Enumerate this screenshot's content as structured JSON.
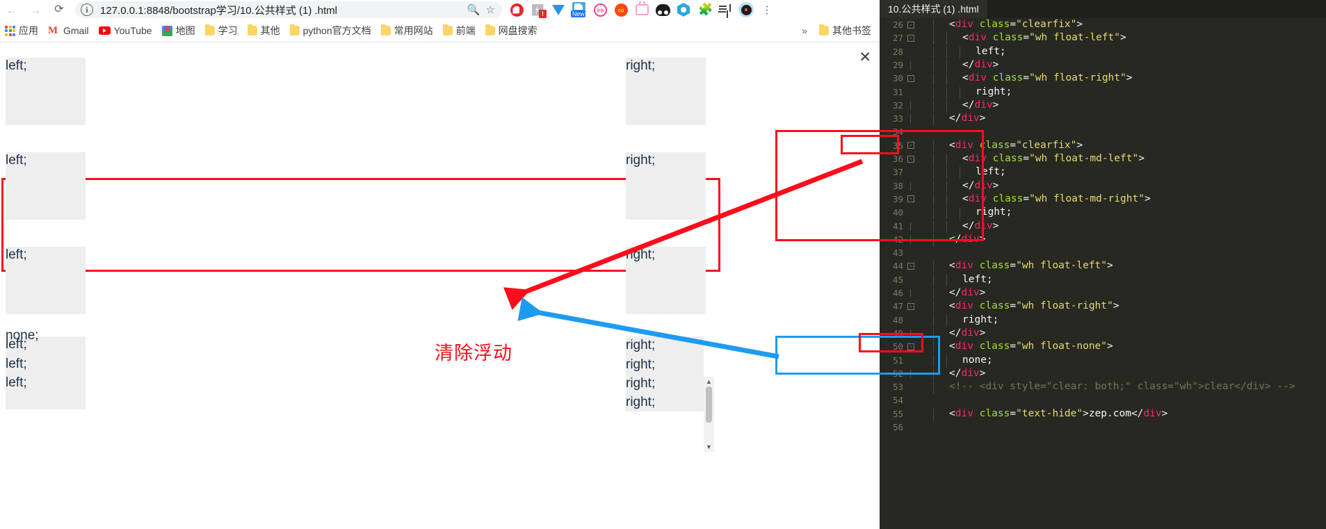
{
  "browser": {
    "nav": {
      "back_icon": "arrow-left-icon",
      "forward_icon": "arrow-right-icon",
      "reload_icon": "reload-icon"
    },
    "omnibox": {
      "info_icon": "site-info-icon",
      "url": "127.0.0.1:8848/bootstrap学习/10.公共样式 (1) .html",
      "zoom_icon": "zoom-icon",
      "star_icon": "bookmark-star-icon"
    },
    "extensions": [
      {
        "name": "adblock-extension-icon"
      },
      {
        "name": "tampermonkey-extension-icon",
        "badge": "!"
      },
      {
        "name": "diamond-extension-icon"
      },
      {
        "name": "new-tab-extension-icon",
        "badge": "New"
      },
      {
        "name": "fast-forward-extension-icon"
      },
      {
        "name": "infinity-extension-icon"
      },
      {
        "name": "tv-extension-icon"
      },
      {
        "name": "panda-extension-icon"
      },
      {
        "name": "hexagon-extension-icon"
      },
      {
        "name": "puzzle-extensions-icon"
      },
      {
        "name": "notes-music-extension-icon"
      },
      {
        "name": "profile-avatar-icon"
      },
      {
        "name": "kebab-menu-icon"
      }
    ],
    "bookmarks": [
      {
        "label": "应用",
        "icon": "apps-grid-icon"
      },
      {
        "label": "Gmail",
        "icon": "gmail-icon"
      },
      {
        "label": "YouTube",
        "icon": "youtube-icon"
      },
      {
        "label": "地图",
        "icon": "google-maps-icon"
      },
      {
        "label": "学习",
        "icon": "folder-icon"
      },
      {
        "label": "其他",
        "icon": "folder-icon"
      },
      {
        "label": "python官方文档",
        "icon": "folder-icon"
      },
      {
        "label": "常用网站",
        "icon": "folder-icon"
      },
      {
        "label": "前端",
        "icon": "folder-icon"
      },
      {
        "label": "网盘搜索",
        "icon": "folder-icon"
      }
    ],
    "bookmark_overflow_label": "»",
    "other_bookmarks": {
      "label": "其他书签",
      "icon": "folder-icon"
    }
  },
  "page": {
    "close_label": "✕",
    "boxes": {
      "left": "left;",
      "right": "right;",
      "none": "none;"
    },
    "rows": [
      {
        "left": "left;",
        "right": "right;",
        "highlighted": false
      },
      {
        "left": "left;",
        "right": "right;",
        "highlighted": true
      },
      {
        "left": "left;",
        "right": "right;",
        "highlighted": false
      }
    ],
    "bottom_stack": {
      "none": "none;",
      "lefts": [
        "left;",
        "left;",
        "left;"
      ],
      "rights": [
        "right;",
        "right;",
        "right;",
        "right;"
      ]
    },
    "scrollbar": {
      "up_arrow": "▲",
      "down_arrow": "▼"
    }
  },
  "annotation": {
    "text": "清除浮动",
    "red_color": "#fc0d1b",
    "blue_color": "#1e9bf0"
  },
  "editor": {
    "tab_title": "10.公共样式 (1) .html",
    "lines": [
      {
        "no": "26",
        "fold": "minus",
        "indent": 2,
        "tokens": [
          {
            "t": "<",
            "c": "pun"
          },
          {
            "t": "div",
            "c": "tag"
          },
          {
            "t": " ",
            "c": "txt"
          },
          {
            "t": "class",
            "c": "attr"
          },
          {
            "t": "=",
            "c": "pun"
          },
          {
            "t": "\"clearfix\"",
            "c": "str"
          },
          {
            "t": ">",
            "c": "pun"
          }
        ]
      },
      {
        "no": "27",
        "fold": "minus",
        "indent": 3,
        "tokens": [
          {
            "t": "<",
            "c": "pun"
          },
          {
            "t": "div",
            "c": "tag"
          },
          {
            "t": " ",
            "c": "txt"
          },
          {
            "t": "class",
            "c": "attr"
          },
          {
            "t": "=",
            "c": "pun"
          },
          {
            "t": "\"wh float-left\"",
            "c": "str"
          },
          {
            "t": ">",
            "c": "pun"
          }
        ]
      },
      {
        "no": "28",
        "fold": "",
        "indent": 4,
        "tokens": [
          {
            "t": "left;",
            "c": "txt"
          }
        ]
      },
      {
        "no": "29",
        "fold": "line",
        "indent": 3,
        "tokens": [
          {
            "t": "</",
            "c": "pun"
          },
          {
            "t": "div",
            "c": "tag"
          },
          {
            "t": ">",
            "c": "pun"
          }
        ]
      },
      {
        "no": "30",
        "fold": "minus",
        "indent": 3,
        "tokens": [
          {
            "t": "<",
            "c": "pun"
          },
          {
            "t": "div",
            "c": "tag"
          },
          {
            "t": " ",
            "c": "txt"
          },
          {
            "t": "class",
            "c": "attr"
          },
          {
            "t": "=",
            "c": "pun"
          },
          {
            "t": "\"wh float-right\"",
            "c": "str"
          },
          {
            "t": ">",
            "c": "pun"
          }
        ]
      },
      {
        "no": "31",
        "fold": "",
        "indent": 4,
        "tokens": [
          {
            "t": "right;",
            "c": "txt"
          }
        ]
      },
      {
        "no": "32",
        "fold": "line",
        "indent": 3,
        "tokens": [
          {
            "t": "</",
            "c": "pun"
          },
          {
            "t": "div",
            "c": "tag"
          },
          {
            "t": ">",
            "c": "pun"
          }
        ]
      },
      {
        "no": "33",
        "fold": "line",
        "indent": 2,
        "tokens": [
          {
            "t": "</",
            "c": "pun"
          },
          {
            "t": "div",
            "c": "tag"
          },
          {
            "t": ">",
            "c": "pun"
          }
        ]
      },
      {
        "no": "34",
        "fold": "",
        "indent": 0,
        "tokens": []
      },
      {
        "no": "35",
        "fold": "minus",
        "indent": 2,
        "tokens": [
          {
            "t": "<",
            "c": "pun"
          },
          {
            "t": "div",
            "c": "tag"
          },
          {
            "t": " ",
            "c": "txt"
          },
          {
            "t": "class",
            "c": "attr"
          },
          {
            "t": "=",
            "c": "pun"
          },
          {
            "t": "\"clearfix\"",
            "c": "str"
          },
          {
            "t": ">",
            "c": "pun"
          }
        ]
      },
      {
        "no": "36",
        "fold": "minus",
        "indent": 3,
        "tokens": [
          {
            "t": "<",
            "c": "pun"
          },
          {
            "t": "div",
            "c": "tag"
          },
          {
            "t": " ",
            "c": "txt"
          },
          {
            "t": "class",
            "c": "attr"
          },
          {
            "t": "=",
            "c": "pun"
          },
          {
            "t": "\"wh float-md-left\"",
            "c": "str"
          },
          {
            "t": ">",
            "c": "pun"
          }
        ]
      },
      {
        "no": "37",
        "fold": "",
        "indent": 4,
        "tokens": [
          {
            "t": "left;",
            "c": "txt"
          }
        ]
      },
      {
        "no": "38",
        "fold": "line",
        "indent": 3,
        "tokens": [
          {
            "t": "</",
            "c": "pun"
          },
          {
            "t": "div",
            "c": "tag"
          },
          {
            "t": ">",
            "c": "pun"
          }
        ]
      },
      {
        "no": "39",
        "fold": "minus",
        "indent": 3,
        "tokens": [
          {
            "t": "<",
            "c": "pun"
          },
          {
            "t": "div",
            "c": "tag"
          },
          {
            "t": " ",
            "c": "txt"
          },
          {
            "t": "class",
            "c": "attr"
          },
          {
            "t": "=",
            "c": "pun"
          },
          {
            "t": "\"wh float-md-right\"",
            "c": "str"
          },
          {
            "t": ">",
            "c": "pun"
          }
        ]
      },
      {
        "no": "40",
        "fold": "",
        "indent": 4,
        "tokens": [
          {
            "t": "right;",
            "c": "txt"
          }
        ]
      },
      {
        "no": "41",
        "fold": "line",
        "indent": 3,
        "tokens": [
          {
            "t": "</",
            "c": "pun"
          },
          {
            "t": "div",
            "c": "tag"
          },
          {
            "t": ">",
            "c": "pun"
          }
        ]
      },
      {
        "no": "42",
        "fold": "line",
        "indent": 2,
        "tokens": [
          {
            "t": "</",
            "c": "pun"
          },
          {
            "t": "div",
            "c": "tag"
          },
          {
            "t": ">",
            "c": "pun"
          }
        ]
      },
      {
        "no": "43",
        "fold": "",
        "indent": 0,
        "tokens": []
      },
      {
        "no": "44",
        "fold": "minus",
        "indent": 2,
        "tokens": [
          {
            "t": "<",
            "c": "pun"
          },
          {
            "t": "div",
            "c": "tag"
          },
          {
            "t": " ",
            "c": "txt"
          },
          {
            "t": "class",
            "c": "attr"
          },
          {
            "t": "=",
            "c": "pun"
          },
          {
            "t": "\"wh float-left\"",
            "c": "str"
          },
          {
            "t": ">",
            "c": "pun"
          }
        ]
      },
      {
        "no": "45",
        "fold": "",
        "indent": 3,
        "tokens": [
          {
            "t": "left;",
            "c": "txt"
          }
        ]
      },
      {
        "no": "46",
        "fold": "line",
        "indent": 2,
        "tokens": [
          {
            "t": "</",
            "c": "pun"
          },
          {
            "t": "div",
            "c": "tag"
          },
          {
            "t": ">",
            "c": "pun"
          }
        ]
      },
      {
        "no": "47",
        "fold": "minus",
        "indent": 2,
        "tokens": [
          {
            "t": "<",
            "c": "pun"
          },
          {
            "t": "div",
            "c": "tag"
          },
          {
            "t": " ",
            "c": "txt"
          },
          {
            "t": "class",
            "c": "attr"
          },
          {
            "t": "=",
            "c": "pun"
          },
          {
            "t": "\"wh float-right\"",
            "c": "str"
          },
          {
            "t": ">",
            "c": "pun"
          }
        ]
      },
      {
        "no": "48",
        "fold": "",
        "indent": 3,
        "tokens": [
          {
            "t": "right;",
            "c": "txt"
          }
        ]
      },
      {
        "no": "49",
        "fold": "line",
        "indent": 2,
        "tokens": [
          {
            "t": "</",
            "c": "pun"
          },
          {
            "t": "div",
            "c": "tag"
          },
          {
            "t": ">",
            "c": "pun"
          }
        ]
      },
      {
        "no": "50",
        "fold": "minus",
        "indent": 2,
        "tokens": [
          {
            "t": "<",
            "c": "pun"
          },
          {
            "t": "div",
            "c": "tag"
          },
          {
            "t": " ",
            "c": "txt"
          },
          {
            "t": "class",
            "c": "attr"
          },
          {
            "t": "=",
            "c": "pun"
          },
          {
            "t": "\"wh float-none\"",
            "c": "str"
          },
          {
            "t": ">",
            "c": "pun"
          }
        ]
      },
      {
        "no": "51",
        "fold": "",
        "indent": 3,
        "tokens": [
          {
            "t": "none;",
            "c": "txt"
          }
        ]
      },
      {
        "no": "52",
        "fold": "line",
        "indent": 2,
        "tokens": [
          {
            "t": "</",
            "c": "pun"
          },
          {
            "t": "div",
            "c": "tag"
          },
          {
            "t": ">",
            "c": "pun"
          }
        ]
      },
      {
        "no": "53",
        "fold": "",
        "indent": 2,
        "tokens": [
          {
            "t": "<!-- <div style=\"clear: both;\" class=\"wh\">clear</div> -->",
            "c": "com"
          }
        ]
      },
      {
        "no": "54",
        "fold": "",
        "indent": 0,
        "tokens": []
      },
      {
        "no": "55",
        "fold": "",
        "indent": 2,
        "tokens": [
          {
            "t": "<",
            "c": "pun"
          },
          {
            "t": "div",
            "c": "tag"
          },
          {
            "t": " ",
            "c": "txt"
          },
          {
            "t": "class",
            "c": "attr"
          },
          {
            "t": "=",
            "c": "pun"
          },
          {
            "t": "\"text-hide\"",
            "c": "str"
          },
          {
            "t": ">",
            "c": "pun"
          },
          {
            "t": "zep.com",
            "c": "txt"
          },
          {
            "t": "</",
            "c": "pun"
          },
          {
            "t": "div",
            "c": "tag"
          },
          {
            "t": ">",
            "c": "pun"
          }
        ]
      },
      {
        "no": "56",
        "fold": "",
        "indent": 0,
        "tokens": []
      }
    ]
  }
}
